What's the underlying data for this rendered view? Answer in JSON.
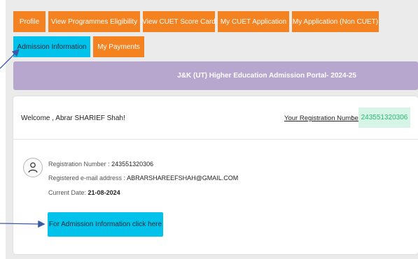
{
  "nav": {
    "tabs": [
      {
        "label": "Profile"
      },
      {
        "label": "View Programmes Eligibility"
      },
      {
        "label": "View CUET Score Card"
      },
      {
        "label": "My CUET Application"
      },
      {
        "label": "My Application (Non CUET)"
      },
      {
        "label": "Admission Information"
      },
      {
        "label": "My Payments"
      }
    ],
    "active_tab": "Admission Information"
  },
  "banner": {
    "title": "J&K (UT) Higher Education Admission Portal- 2024-25"
  },
  "welcome": {
    "greeting": "Welcome , Abrar SHARIEF Shah!",
    "regno_label": "Your Registration Number is",
    "regno_colon": ":",
    "regno_value": "243551320306"
  },
  "profile": {
    "registration_label": "Registration Number :",
    "registration_value": "243551320306",
    "email_label": "Registered e-mail address :",
    "email_value": "ABRARSHAREEFSHAH@GMAIL.COM",
    "date_label": "Current Date:",
    "date_value": "21-08-2024",
    "avatar_icon": "user-icon"
  },
  "actions": {
    "admission_button": "For Admission Information click here"
  },
  "colors": {
    "tab_orange": "#f58220",
    "tab_active": "#00c2ea",
    "banner": "#b7a7cf",
    "regno_badge_bg": "#d7f5e6",
    "regno_badge_text": "#2bb673",
    "annotation_arrow": "#3a5aa8"
  }
}
